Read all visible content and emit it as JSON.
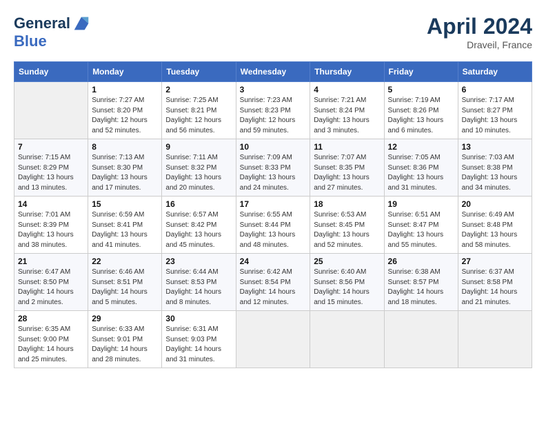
{
  "header": {
    "logo_line1": "General",
    "logo_line2": "Blue",
    "month": "April 2024",
    "location": "Draveil, France"
  },
  "days_of_week": [
    "Sunday",
    "Monday",
    "Tuesday",
    "Wednesday",
    "Thursday",
    "Friday",
    "Saturday"
  ],
  "weeks": [
    [
      {
        "day": "",
        "empty": true
      },
      {
        "day": "1",
        "sunrise": "7:27 AM",
        "sunset": "8:20 PM",
        "daylight": "12 hours and 52 minutes."
      },
      {
        "day": "2",
        "sunrise": "7:25 AM",
        "sunset": "8:21 PM",
        "daylight": "12 hours and 56 minutes."
      },
      {
        "day": "3",
        "sunrise": "7:23 AM",
        "sunset": "8:23 PM",
        "daylight": "12 hours and 59 minutes."
      },
      {
        "day": "4",
        "sunrise": "7:21 AM",
        "sunset": "8:24 PM",
        "daylight": "13 hours and 3 minutes."
      },
      {
        "day": "5",
        "sunrise": "7:19 AM",
        "sunset": "8:26 PM",
        "daylight": "13 hours and 6 minutes."
      },
      {
        "day": "6",
        "sunrise": "7:17 AM",
        "sunset": "8:27 PM",
        "daylight": "13 hours and 10 minutes."
      }
    ],
    [
      {
        "day": "7",
        "sunrise": "7:15 AM",
        "sunset": "8:29 PM",
        "daylight": "13 hours and 13 minutes."
      },
      {
        "day": "8",
        "sunrise": "7:13 AM",
        "sunset": "8:30 PM",
        "daylight": "13 hours and 17 minutes."
      },
      {
        "day": "9",
        "sunrise": "7:11 AM",
        "sunset": "8:32 PM",
        "daylight": "13 hours and 20 minutes."
      },
      {
        "day": "10",
        "sunrise": "7:09 AM",
        "sunset": "8:33 PM",
        "daylight": "13 hours and 24 minutes."
      },
      {
        "day": "11",
        "sunrise": "7:07 AM",
        "sunset": "8:35 PM",
        "daylight": "13 hours and 27 minutes."
      },
      {
        "day": "12",
        "sunrise": "7:05 AM",
        "sunset": "8:36 PM",
        "daylight": "13 hours and 31 minutes."
      },
      {
        "day": "13",
        "sunrise": "7:03 AM",
        "sunset": "8:38 PM",
        "daylight": "13 hours and 34 minutes."
      }
    ],
    [
      {
        "day": "14",
        "sunrise": "7:01 AM",
        "sunset": "8:39 PM",
        "daylight": "13 hours and 38 minutes."
      },
      {
        "day": "15",
        "sunrise": "6:59 AM",
        "sunset": "8:41 PM",
        "daylight": "13 hours and 41 minutes."
      },
      {
        "day": "16",
        "sunrise": "6:57 AM",
        "sunset": "8:42 PM",
        "daylight": "13 hours and 45 minutes."
      },
      {
        "day": "17",
        "sunrise": "6:55 AM",
        "sunset": "8:44 PM",
        "daylight": "13 hours and 48 minutes."
      },
      {
        "day": "18",
        "sunrise": "6:53 AM",
        "sunset": "8:45 PM",
        "daylight": "13 hours and 52 minutes."
      },
      {
        "day": "19",
        "sunrise": "6:51 AM",
        "sunset": "8:47 PM",
        "daylight": "13 hours and 55 minutes."
      },
      {
        "day": "20",
        "sunrise": "6:49 AM",
        "sunset": "8:48 PM",
        "daylight": "13 hours and 58 minutes."
      }
    ],
    [
      {
        "day": "21",
        "sunrise": "6:47 AM",
        "sunset": "8:50 PM",
        "daylight": "14 hours and 2 minutes."
      },
      {
        "day": "22",
        "sunrise": "6:46 AM",
        "sunset": "8:51 PM",
        "daylight": "14 hours and 5 minutes."
      },
      {
        "day": "23",
        "sunrise": "6:44 AM",
        "sunset": "8:53 PM",
        "daylight": "14 hours and 8 minutes."
      },
      {
        "day": "24",
        "sunrise": "6:42 AM",
        "sunset": "8:54 PM",
        "daylight": "14 hours and 12 minutes."
      },
      {
        "day": "25",
        "sunrise": "6:40 AM",
        "sunset": "8:56 PM",
        "daylight": "14 hours and 15 minutes."
      },
      {
        "day": "26",
        "sunrise": "6:38 AM",
        "sunset": "8:57 PM",
        "daylight": "14 hours and 18 minutes."
      },
      {
        "day": "27",
        "sunrise": "6:37 AM",
        "sunset": "8:58 PM",
        "daylight": "14 hours and 21 minutes."
      }
    ],
    [
      {
        "day": "28",
        "sunrise": "6:35 AM",
        "sunset": "9:00 PM",
        "daylight": "14 hours and 25 minutes."
      },
      {
        "day": "29",
        "sunrise": "6:33 AM",
        "sunset": "9:01 PM",
        "daylight": "14 hours and 28 minutes."
      },
      {
        "day": "30",
        "sunrise": "6:31 AM",
        "sunset": "9:03 PM",
        "daylight": "14 hours and 31 minutes."
      },
      {
        "day": "",
        "empty": true
      },
      {
        "day": "",
        "empty": true
      },
      {
        "day": "",
        "empty": true
      },
      {
        "day": "",
        "empty": true
      }
    ]
  ],
  "labels": {
    "sunrise": "Sunrise:",
    "sunset": "Sunset:",
    "daylight": "Daylight:"
  }
}
